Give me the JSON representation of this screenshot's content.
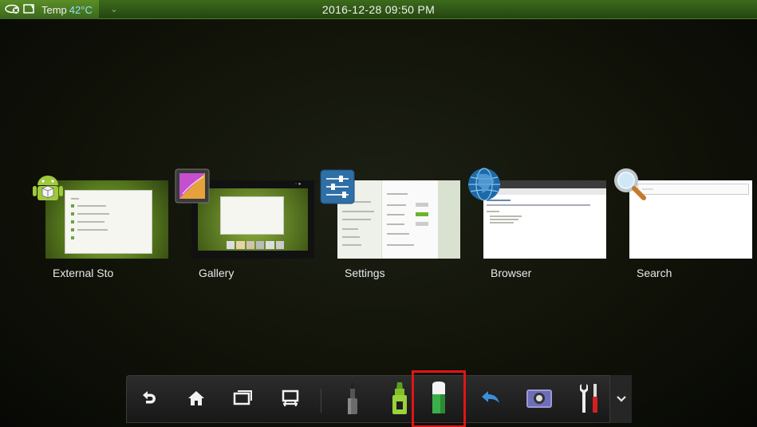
{
  "statusbar": {
    "temp_label": "Temp",
    "temp_value": "42°C",
    "datetime": "2016-12-28  09:50  PM"
  },
  "recents": [
    {
      "label": "External Sto",
      "icon": "android-icon"
    },
    {
      "label": "Gallery",
      "icon": "gallery-icon"
    },
    {
      "label": "Settings",
      "icon": "settings-icon"
    },
    {
      "label": "Browser",
      "icon": "globe-icon"
    },
    {
      "label": "Search",
      "icon": "magnifier-icon"
    }
  ],
  "toolbar": {
    "buttons": [
      "back-icon",
      "home-icon",
      "recent-apps-icon",
      "desktop-icon",
      "pen-icon",
      "highlighter-icon",
      "eraser-icon",
      "undo-icon",
      "camera-icon",
      "tools-icon"
    ],
    "selected": "eraser-icon",
    "more_icon": "chevron-down-icon"
  },
  "colors": {
    "status_green": "#2f5a16",
    "selection": "#e01515",
    "accent_green": "#6ab42a"
  }
}
